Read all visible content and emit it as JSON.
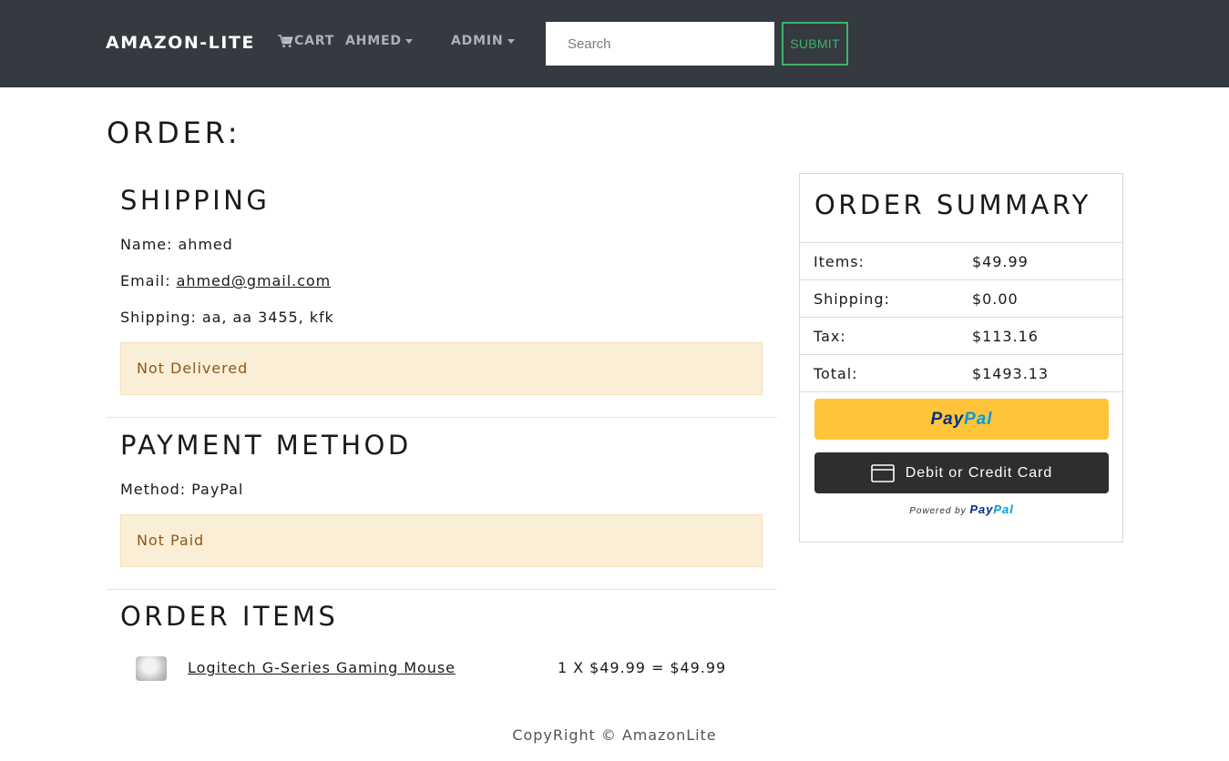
{
  "nav": {
    "brand": "AMAZON-LITE",
    "cart_label": "CART",
    "user_label": "AHMED",
    "admin_label": "ADMIN",
    "search_placeholder": "Search",
    "submit_label": "SUBMIT"
  },
  "page": {
    "title": "ORDER:"
  },
  "shipping": {
    "title": "SHIPPING",
    "name_label": "Name:",
    "name_value": "ahmed",
    "email_label": "Email:",
    "email_value": "ahmed@gmail.com",
    "address_label": "Shipping:",
    "address_value": "aa, aa 3455, kfk",
    "status": "Not Delivered"
  },
  "payment": {
    "title": "PAYMENT METHOD",
    "method_label": "Method:",
    "method_value": "PayPal",
    "status": "Not Paid"
  },
  "order_items": {
    "title": "ORDER ITEMS",
    "items": [
      {
        "name": "Logitech G-Series Gaming Mouse",
        "price_line": "1 X $49.99 = $49.99"
      }
    ]
  },
  "summary": {
    "title": "ORDER SUMMARY",
    "rows": [
      {
        "label": "Items:",
        "value": "$49.99"
      },
      {
        "label": "Shipping:",
        "value": "$0.00"
      },
      {
        "label": "Tax:",
        "value": "$113.16"
      },
      {
        "label": "Total:",
        "value": "$1493.13"
      }
    ],
    "paypal_word_a": "Pay",
    "paypal_word_b": "Pal",
    "card_button_label": "Debit or Credit Card",
    "powered_by": "Powered by",
    "powered_brand_a": "Pay",
    "powered_brand_b": "Pal"
  },
  "footer": {
    "text": "CopyRight © AmazonLite"
  },
  "colors": {
    "navbar_bg": "#343a40",
    "submit_green": "#3fb26b",
    "alert_bg": "#fbeed7",
    "alert_text": "#8a5a1e",
    "paypal_yellow": "#ffc439",
    "card_dark": "#2c2e2f"
  }
}
